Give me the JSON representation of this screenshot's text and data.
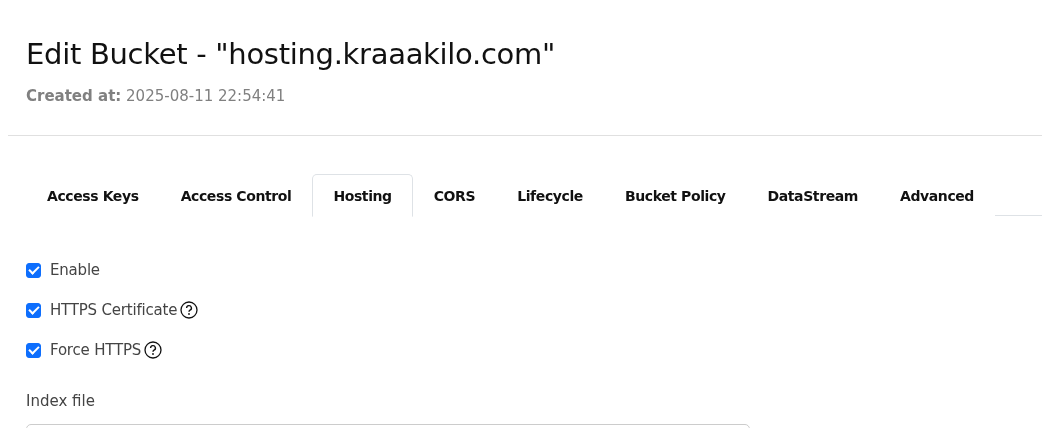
{
  "header": {
    "title": "Edit Bucket - \"hosting.kraaakilo.com\"",
    "created_label": "Created at:",
    "created_value": "2025-08-11 22:54:41"
  },
  "tabs": [
    {
      "label": "Access Keys",
      "selected": false
    },
    {
      "label": "Access Control",
      "selected": false
    },
    {
      "label": "Hosting",
      "selected": true
    },
    {
      "label": "CORS",
      "selected": false
    },
    {
      "label": "Lifecycle",
      "selected": false
    },
    {
      "label": "Bucket Policy",
      "selected": false
    },
    {
      "label": "DataStream",
      "selected": false
    },
    {
      "label": "Advanced",
      "selected": false
    }
  ],
  "options": [
    {
      "label": "Enable",
      "checked": true,
      "help": false
    },
    {
      "label": "HTTPS Certificate",
      "checked": true,
      "help": true
    },
    {
      "label": "Force HTTPS",
      "checked": true,
      "help": true
    }
  ],
  "index_file": {
    "label": "Index file"
  }
}
